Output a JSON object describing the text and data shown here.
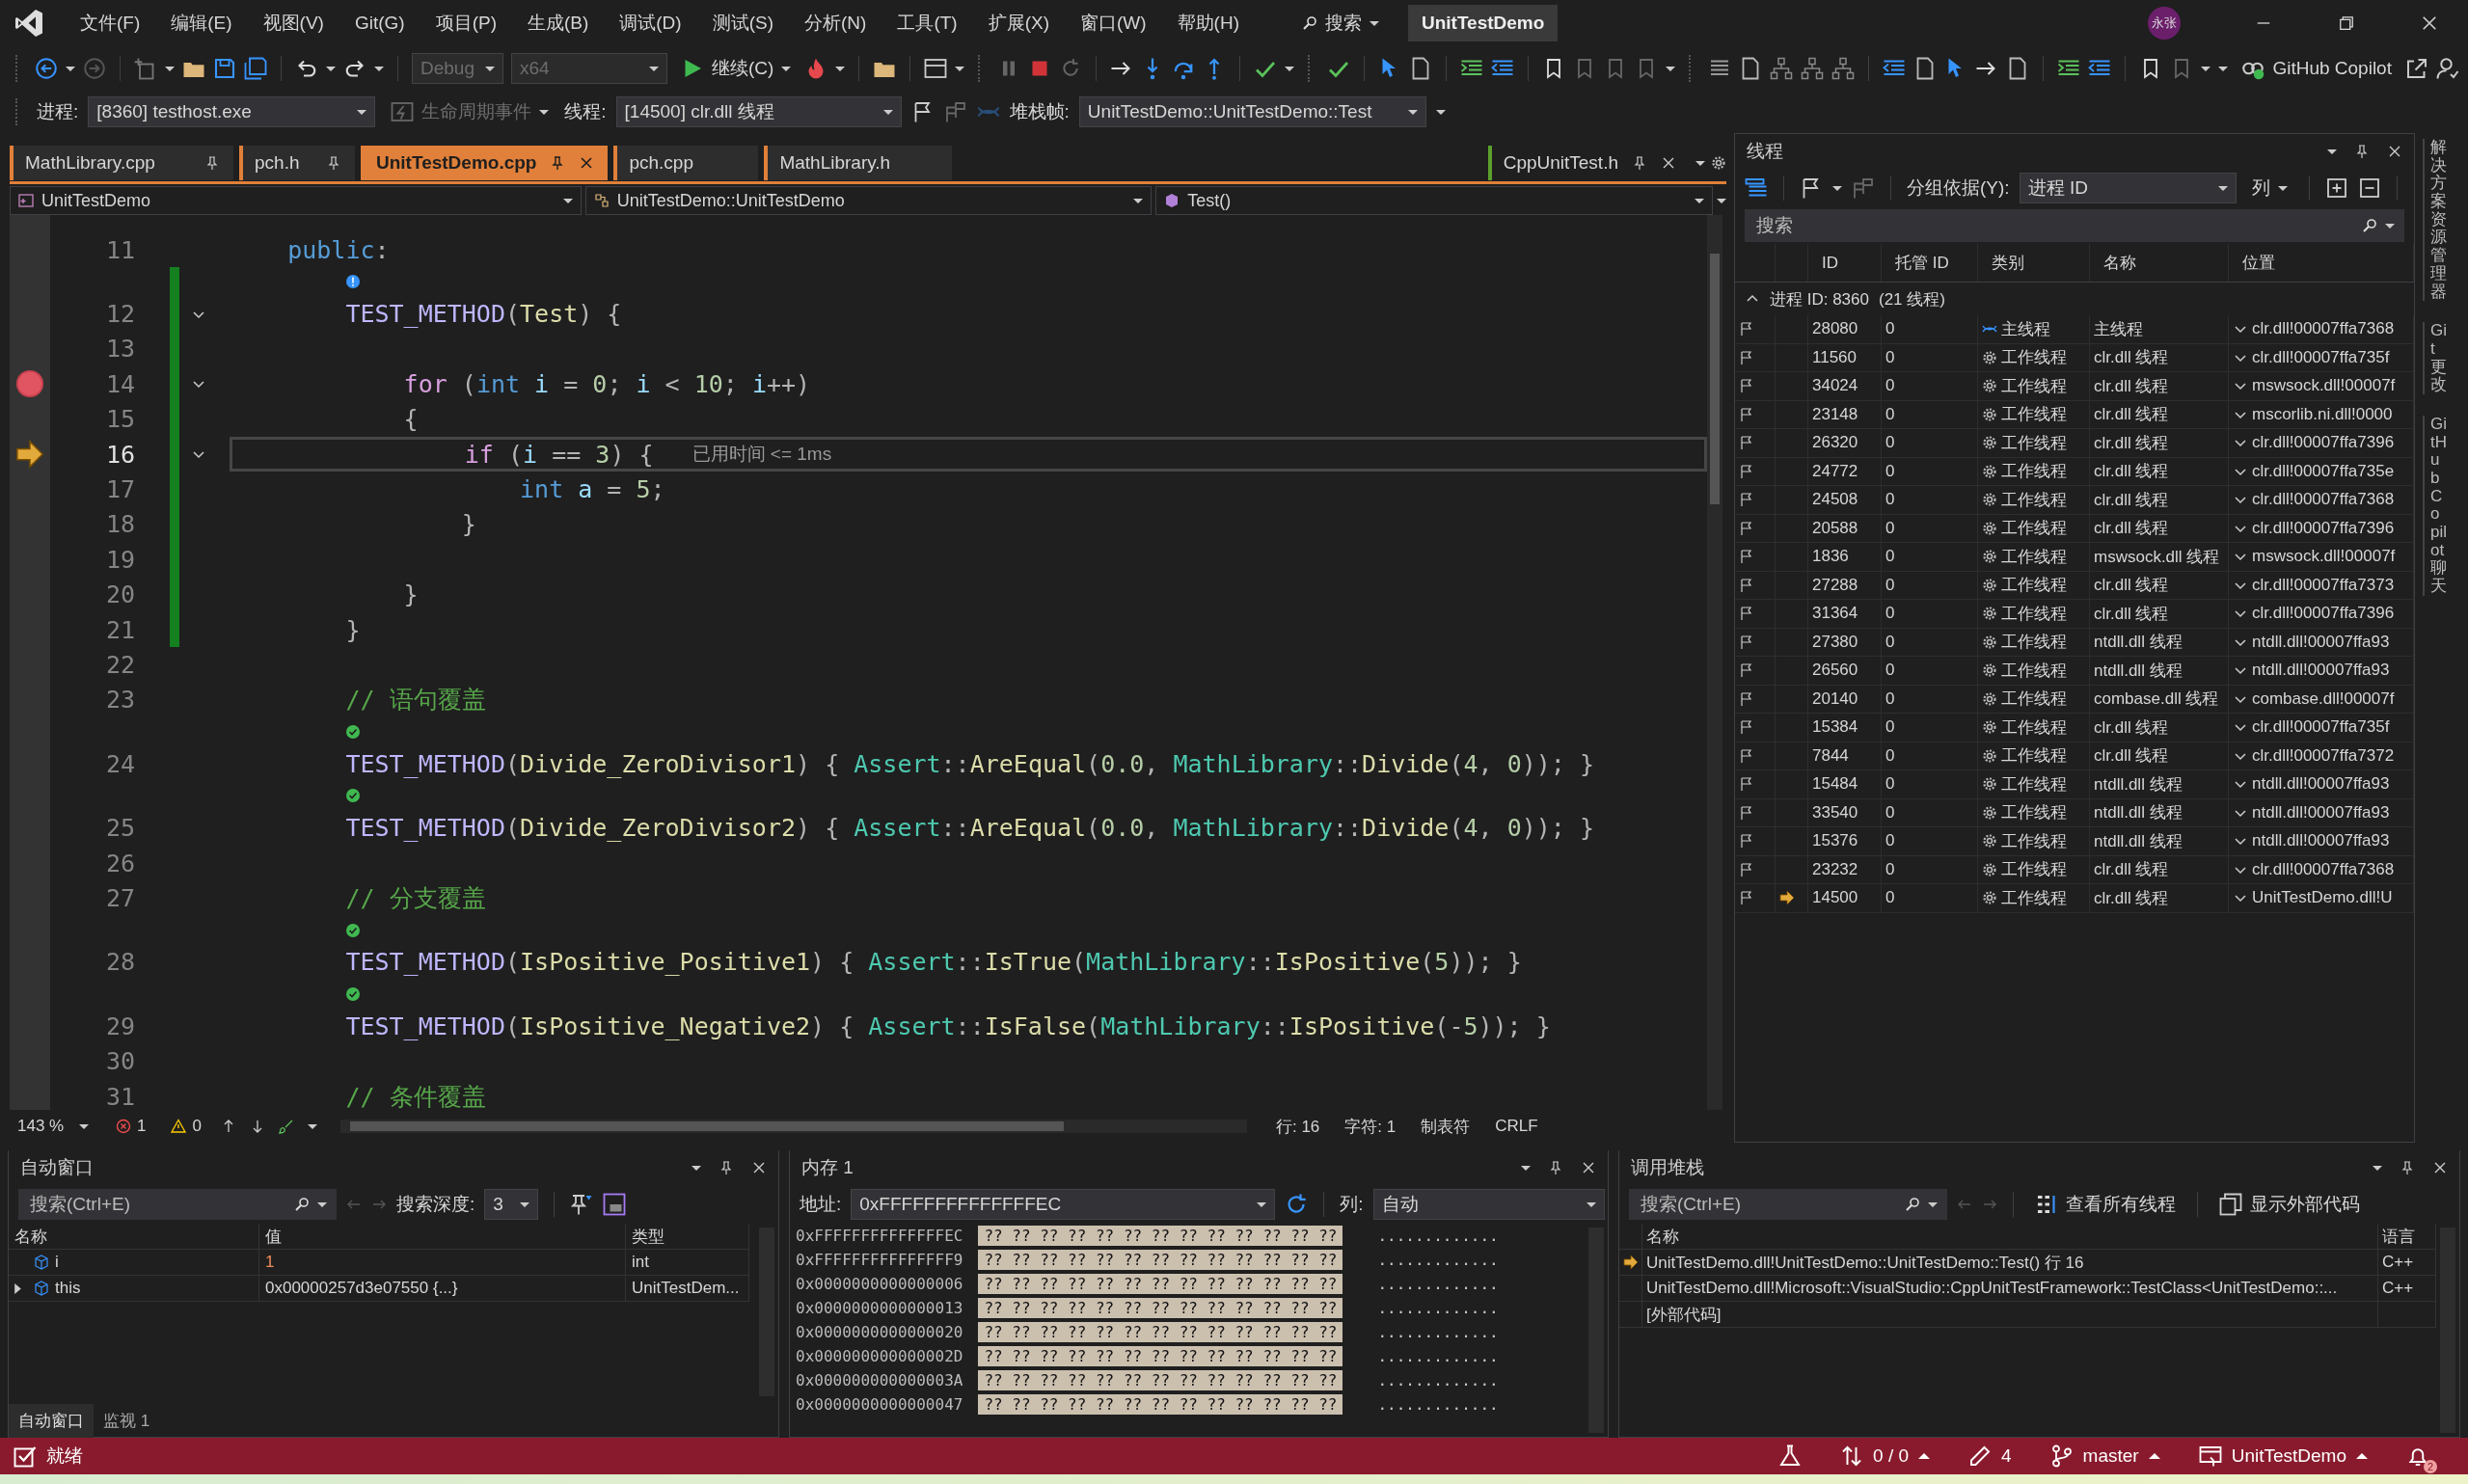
{
  "menu": {
    "items": [
      "文件(F)",
      "编辑(E)",
      "视图(V)",
      "Git(G)",
      "项目(P)",
      "生成(B)",
      "调试(D)",
      "测试(S)",
      "分析(N)",
      "工具(T)",
      "扩展(X)",
      "窗口(W)",
      "帮助(H)"
    ],
    "search": "搜索",
    "solution": "UnitTestDemo",
    "avatar": "永张"
  },
  "toolbar": {
    "configuration": {
      "value": "Debug",
      "disabled": true
    },
    "platform": {
      "value": "x64",
      "disabled": true
    },
    "continue": "继续(C)",
    "copilot": "GitHub Copilot"
  },
  "debug_location": {
    "process_label": "进程:",
    "process": "[8360] testhost.exe",
    "lifecycle": {
      "label": "生命周期事件",
      "disabled": true
    },
    "thread_label": "线程:",
    "thread": "[14500] clr.dll 线程",
    "frame_label": "堆栈帧:",
    "frame": "UnitTestDemo::UnitTestDemo::Test"
  },
  "tabs": [
    {
      "label": "MathLibrary.cpp",
      "selected": false,
      "pinned": true
    },
    {
      "label": "pch.h",
      "selected": false,
      "pinned": true
    },
    {
      "label": "UnitTestDemo.cpp",
      "selected": true,
      "pinned": true
    },
    {
      "label": "pch.cpp",
      "selected": false,
      "pinned": false
    },
    {
      "label": "MathLibrary.h",
      "selected": false,
      "pinned": false
    }
  ],
  "right_tabs": [
    {
      "label": "CppUnitTest.h",
      "selected": false,
      "pinned": true
    }
  ],
  "navigation": {
    "project": "UnitTestDemo",
    "scope": "UnitTestDemo::UnitTestDemo",
    "member": "Test()"
  },
  "code": {
    "lines": [
      {
        "number": "11",
        "changed": false,
        "fold": false,
        "parts": [
          {
            "text": "    public",
            "kind": "kw"
          },
          {
            "text": ":",
            "kind": "p"
          }
        ]
      },
      {
        "number": "12",
        "lens": {
          "kind": "info"
        },
        "changed": true,
        "fold": true,
        "parts": [
          {
            "text": "        TEST_METHOD",
            "kind": "macro"
          },
          {
            "text": "(",
            "kind": "p"
          },
          {
            "text": "Test",
            "kind": "fn"
          },
          {
            "text": ") {",
            "kind": "p"
          }
        ]
      },
      {
        "number": "13",
        "changed": true,
        "fold": false
      },
      {
        "number": "14",
        "marker": {
          "kind": "breakpoint"
        },
        "changed": true,
        "fold": true,
        "parts": [
          {
            "text": "            for",
            "kind": "ctl"
          },
          {
            "text": " (",
            "kind": "p"
          },
          {
            "text": "int ",
            "kind": "kw"
          },
          {
            "text": "i",
            "kind": "var"
          },
          {
            "text": " = ",
            "kind": "p"
          },
          {
            "text": "0",
            "kind": "num"
          },
          {
            "text": "; ",
            "kind": "p"
          },
          {
            "text": "i",
            "kind": "var"
          },
          {
            "text": " < ",
            "kind": "p"
          },
          {
            "text": "10",
            "kind": "num"
          },
          {
            "text": "; ",
            "kind": "p"
          },
          {
            "text": "i",
            "kind": "var"
          },
          {
            "text": "++)",
            "kind": "p"
          }
        ]
      },
      {
        "number": "15",
        "changed": true,
        "fold": false,
        "parts": [
          {
            "text": "            {",
            "kind": "p"
          }
        ]
      },
      {
        "number": "16",
        "marker": {
          "kind": "current"
        },
        "changed": true,
        "fold": true,
        "hint": "已用时间 <= 1ms",
        "parts": [
          {
            "text": "                if",
            "kind": "ctl"
          },
          {
            "text": " (",
            "kind": "p"
          },
          {
            "text": "i",
            "kind": "var"
          },
          {
            "text": " == ",
            "kind": "p"
          },
          {
            "text": "3",
            "kind": "num"
          },
          {
            "text": ") {",
            "kind": "p"
          }
        ]
      },
      {
        "number": "17",
        "changed": true,
        "fold": false,
        "parts": [
          {
            "text": "                    int ",
            "kind": "kw"
          },
          {
            "text": "a",
            "kind": "var"
          },
          {
            "text": " = ",
            "kind": "p"
          },
          {
            "text": "5",
            "kind": "num"
          },
          {
            "text": ";",
            "kind": "p"
          }
        ]
      },
      {
        "number": "18",
        "changed": true,
        "fold": false,
        "parts": [
          {
            "text": "                }",
            "kind": "p"
          }
        ]
      },
      {
        "number": "19",
        "changed": true,
        "fold": false
      },
      {
        "number": "20",
        "changed": true,
        "fold": false,
        "parts": [
          {
            "text": "            }",
            "kind": "p"
          }
        ]
      },
      {
        "number": "21",
        "changed": true,
        "fold": false,
        "parts": [
          {
            "text": "        }",
            "kind": "p"
          }
        ]
      },
      {
        "number": "22",
        "changed": false,
        "fold": false
      },
      {
        "number": "23",
        "changed": false,
        "fold": false,
        "parts": [
          {
            "text": "        // 语句覆盖",
            "kind": "cm"
          }
        ]
      },
      {
        "number": "24",
        "lens": {
          "kind": "pass"
        },
        "changed": false,
        "fold": false,
        "parts": [
          {
            "text": "        TEST_METHOD",
            "kind": "macro"
          },
          {
            "text": "(",
            "kind": "p"
          },
          {
            "text": "Divide_ZeroDivisor1",
            "kind": "fn"
          },
          {
            "text": ") { ",
            "kind": "p"
          },
          {
            "text": "Assert",
            "kind": "type"
          },
          {
            "text": "::",
            "kind": "p"
          },
          {
            "text": "AreEqual",
            "kind": "fn"
          },
          {
            "text": "(",
            "kind": "p"
          },
          {
            "text": "0.0",
            "kind": "num"
          },
          {
            "text": ", ",
            "kind": "p"
          },
          {
            "text": "MathLibrary",
            "kind": "type"
          },
          {
            "text": "::",
            "kind": "p"
          },
          {
            "text": "Divide",
            "kind": "fn"
          },
          {
            "text": "(",
            "kind": "p"
          },
          {
            "text": "4",
            "kind": "num"
          },
          {
            "text": ", ",
            "kind": "p"
          },
          {
            "text": "0",
            "kind": "num"
          },
          {
            "text": ")); }",
            "kind": "p"
          }
        ]
      },
      {
        "number": "25",
        "lens": {
          "kind": "pass"
        },
        "changed": false,
        "fold": false,
        "parts": [
          {
            "text": "        TEST_METHOD",
            "kind": "macro"
          },
          {
            "text": "(",
            "kind": "p"
          },
          {
            "text": "Divide_ZeroDivisor2",
            "kind": "fn"
          },
          {
            "text": ") { ",
            "kind": "p"
          },
          {
            "text": "Assert",
            "kind": "type"
          },
          {
            "text": "::",
            "kind": "p"
          },
          {
            "text": "AreEqual",
            "kind": "fn"
          },
          {
            "text": "(",
            "kind": "p"
          },
          {
            "text": "0.0",
            "kind": "num"
          },
          {
            "text": ", ",
            "kind": "p"
          },
          {
            "text": "MathLibrary",
            "kind": "type"
          },
          {
            "text": "::",
            "kind": "p"
          },
          {
            "text": "Divide",
            "kind": "fn"
          },
          {
            "text": "(",
            "kind": "p"
          },
          {
            "text": "4",
            "kind": "num"
          },
          {
            "text": ", ",
            "kind": "p"
          },
          {
            "text": "0",
            "kind": "num"
          },
          {
            "text": ")); }",
            "kind": "p"
          }
        ]
      },
      {
        "number": "26",
        "changed": false,
        "fold": false
      },
      {
        "number": "27",
        "changed": false,
        "fold": false,
        "parts": [
          {
            "text": "        // 分支覆盖",
            "kind": "cm"
          }
        ]
      },
      {
        "number": "28",
        "lens": {
          "kind": "pass"
        },
        "changed": false,
        "fold": false,
        "parts": [
          {
            "text": "        TEST_METHOD",
            "kind": "macro"
          },
          {
            "text": "(",
            "kind": "p"
          },
          {
            "text": "IsPositive_Positive1",
            "kind": "fn"
          },
          {
            "text": ") { ",
            "kind": "p"
          },
          {
            "text": "Assert",
            "kind": "type"
          },
          {
            "text": "::",
            "kind": "p"
          },
          {
            "text": "IsTrue",
            "kind": "fn"
          },
          {
            "text": "(",
            "kind": "p"
          },
          {
            "text": "MathLibrary",
            "kind": "type"
          },
          {
            "text": "::",
            "kind": "p"
          },
          {
            "text": "IsPositive",
            "kind": "fn"
          },
          {
            "text": "(",
            "kind": "p"
          },
          {
            "text": "5",
            "kind": "num"
          },
          {
            "text": ")); }",
            "kind": "p"
          }
        ]
      },
      {
        "number": "29",
        "lens": {
          "kind": "pass"
        },
        "changed": false,
        "fold": false,
        "parts": [
          {
            "text": "        TEST_METHOD",
            "kind": "macro"
          },
          {
            "text": "(",
            "kind": "p"
          },
          {
            "text": "IsPositive_Negative2",
            "kind": "fn"
          },
          {
            "text": ") { ",
            "kind": "p"
          },
          {
            "text": "Assert",
            "kind": "type"
          },
          {
            "text": "::",
            "kind": "p"
          },
          {
            "text": "IsFalse",
            "kind": "fn"
          },
          {
            "text": "(",
            "kind": "p"
          },
          {
            "text": "MathLibrary",
            "kind": "type"
          },
          {
            "text": "::",
            "kind": "p"
          },
          {
            "text": "IsPositive",
            "kind": "fn"
          },
          {
            "text": "(-",
            "kind": "p"
          },
          {
            "text": "5",
            "kind": "num"
          },
          {
            "text": ")); }",
            "kind": "p"
          }
        ]
      },
      {
        "number": "30",
        "changed": false,
        "fold": false
      },
      {
        "number": "31",
        "changed": false,
        "fold": false,
        "parts": [
          {
            "text": "        // 条件覆盖",
            "kind": "cm"
          }
        ]
      }
    ]
  },
  "editor_status": {
    "zoom": "143 %",
    "errors": "1",
    "warnings": "0",
    "line": "行: 16",
    "char": "字符: 1",
    "indent": "制表符",
    "eol": "CRLF"
  },
  "threads": {
    "title": "线程",
    "group_label": "分组依据(Y):",
    "group_by": "进程 ID",
    "columns_button": "列",
    "search": {
      "placeholder": "搜索"
    },
    "columns": [
      "ID",
      "托管 ID",
      "类别",
      "名称",
      "位置"
    ],
    "group": {
      "label": "进程 ID: 8360",
      "count": "(21 线程)",
      "expanded": true
    },
    "rows": [
      {
        "thread_id": "28080",
        "managed": "0",
        "kind": "main",
        "category": "主线程",
        "name": "主线程",
        "location": "clr.dll!00007ffa7368",
        "current": false
      },
      {
        "thread_id": "11560",
        "managed": "0",
        "kind": "worker",
        "category": "工作线程",
        "name": "clr.dll 线程",
        "location": "clr.dll!00007ffa735f",
        "current": false
      },
      {
        "thread_id": "34024",
        "managed": "0",
        "kind": "worker",
        "category": "工作线程",
        "name": "clr.dll 线程",
        "location": "mswsock.dll!00007f",
        "current": false
      },
      {
        "thread_id": "23148",
        "managed": "0",
        "kind": "worker",
        "category": "工作线程",
        "name": "clr.dll 线程",
        "location": "mscorlib.ni.dll!0000",
        "current": false
      },
      {
        "thread_id": "26320",
        "managed": "0",
        "kind": "worker",
        "category": "工作线程",
        "name": "clr.dll 线程",
        "location": "clr.dll!00007ffa7396",
        "current": false
      },
      {
        "thread_id": "24772",
        "managed": "0",
        "kind": "worker",
        "category": "工作线程",
        "name": "clr.dll 线程",
        "location": "clr.dll!00007ffa735e",
        "current": false
      },
      {
        "thread_id": "24508",
        "managed": "0",
        "kind": "worker",
        "category": "工作线程",
        "name": "clr.dll 线程",
        "location": "clr.dll!00007ffa7368",
        "current": false
      },
      {
        "thread_id": "20588",
        "managed": "0",
        "kind": "worker",
        "category": "工作线程",
        "name": "clr.dll 线程",
        "location": "clr.dll!00007ffa7396",
        "current": false
      },
      {
        "thread_id": "1836",
        "managed": "0",
        "kind": "worker",
        "category": "工作线程",
        "name": "mswsock.dll 线程",
        "location": "mswsock.dll!00007f",
        "current": false
      },
      {
        "thread_id": "27288",
        "managed": "0",
        "kind": "worker",
        "category": "工作线程",
        "name": "clr.dll 线程",
        "location": "clr.dll!00007ffa7373",
        "current": false
      },
      {
        "thread_id": "31364",
        "managed": "0",
        "kind": "worker",
        "category": "工作线程",
        "name": "clr.dll 线程",
        "location": "clr.dll!00007ffa7396",
        "current": false
      },
      {
        "thread_id": "27380",
        "managed": "0",
        "kind": "worker",
        "category": "工作线程",
        "name": "ntdll.dll 线程",
        "location": "ntdll.dll!00007ffa93",
        "current": false
      },
      {
        "thread_id": "26560",
        "managed": "0",
        "kind": "worker",
        "category": "工作线程",
        "name": "ntdll.dll 线程",
        "location": "ntdll.dll!00007ffa93",
        "current": false
      },
      {
        "thread_id": "20140",
        "managed": "0",
        "kind": "worker",
        "category": "工作线程",
        "name": "combase.dll 线程",
        "location": "combase.dll!00007f",
        "current": false
      },
      {
        "thread_id": "15384",
        "managed": "0",
        "kind": "worker",
        "category": "工作线程",
        "name": "clr.dll 线程",
        "location": "clr.dll!00007ffa735f",
        "current": false
      },
      {
        "thread_id": "7844",
        "managed": "0",
        "kind": "worker",
        "category": "工作线程",
        "name": "clr.dll 线程",
        "location": "clr.dll!00007ffa7372",
        "current": false
      },
      {
        "thread_id": "15484",
        "managed": "0",
        "kind": "worker",
        "category": "工作线程",
        "name": "ntdll.dll 线程",
        "location": "ntdll.dll!00007ffa93",
        "current": false
      },
      {
        "thread_id": "33540",
        "managed": "0",
        "kind": "worker",
        "category": "工作线程",
        "name": "ntdll.dll 线程",
        "location": "ntdll.dll!00007ffa93",
        "current": false
      },
      {
        "thread_id": "15376",
        "managed": "0",
        "kind": "worker",
        "category": "工作线程",
        "name": "ntdll.dll 线程",
        "location": "ntdll.dll!00007ffa93",
        "current": false
      },
      {
        "thread_id": "23232",
        "managed": "0",
        "kind": "worker",
        "category": "工作线程",
        "name": "clr.dll 线程",
        "location": "clr.dll!00007ffa7368",
        "current": false
      },
      {
        "thread_id": "14500",
        "managed": "0",
        "kind": "worker",
        "category": "工作线程",
        "name": "clr.dll 线程",
        "location": "UnitTestDemo.dll!U",
        "current": true
      }
    ]
  },
  "side_tabs": [
    "解决方案资源管理器",
    "Git 更改",
    "GitHub Copilot 聊天"
  ],
  "autos": {
    "title": "自动窗口",
    "search": {
      "placeholder": "搜索(Ctrl+E)"
    },
    "depth_label": "搜索深度:",
    "depth": "3",
    "columns": [
      "名称",
      "值",
      "类型"
    ],
    "rows": [
      {
        "name": "i",
        "value": "1",
        "type": "int",
        "changed": true,
        "expandable": false
      },
      {
        "name": "this",
        "value": "0x00000257d3e07550 {...}",
        "type": "UnitTestDem...",
        "changed": false,
        "expandable": true
      }
    ],
    "tabs": [
      {
        "label": "自动窗口",
        "selected": true
      },
      {
        "label": "监视 1",
        "selected": false
      }
    ]
  },
  "memory": {
    "title": "内存 1",
    "address_label": "地址:",
    "address": "0xFFFFFFFFFFFFFFEC",
    "columns_label": "列:",
    "columns": "自动",
    "rows": [
      {
        "address": "0xFFFFFFFFFFFFFFEC",
        "bytes": "?? ?? ?? ?? ?? ?? ?? ?? ?? ?? ?? ?? ??",
        "text": "............."
      },
      {
        "address": "0xFFFFFFFFFFFFFFF9",
        "bytes": "?? ?? ?? ?? ?? ?? ?? ?? ?? ?? ?? ?? ??",
        "text": "............."
      },
      {
        "address": "0x0000000000000006",
        "bytes": "?? ?? ?? ?? ?? ?? ?? ?? ?? ?? ?? ?? ??",
        "text": "............."
      },
      {
        "address": "0x0000000000000013",
        "bytes": "?? ?? ?? ?? ?? ?? ?? ?? ?? ?? ?? ?? ??",
        "text": "............."
      },
      {
        "address": "0x0000000000000020",
        "bytes": "?? ?? ?? ?? ?? ?? ?? ?? ?? ?? ?? ?? ??",
        "text": "............."
      },
      {
        "address": "0x000000000000002D",
        "bytes": "?? ?? ?? ?? ?? ?? ?? ?? ?? ?? ?? ?? ??",
        "text": "............."
      },
      {
        "address": "0x000000000000003A",
        "bytes": "?? ?? ?? ?? ?? ?? ?? ?? ?? ?? ?? ?? ??",
        "text": "............."
      },
      {
        "address": "0x0000000000000047",
        "bytes": "?? ?? ?? ?? ?? ?? ?? ?? ?? ?? ?? ?? ??",
        "text": "............."
      }
    ]
  },
  "call_stack": {
    "title": "调用堆栈",
    "search": {
      "placeholder": "搜索(Ctrl+E)"
    },
    "all_threads": "查看所有线程",
    "external": "显示外部代码",
    "columns": [
      "名称",
      "语言"
    ],
    "rows": [
      {
        "name": "UnitTestDemo.dll!UnitTestDemo::UnitTestDemo::Test() 行 16",
        "language": "C++",
        "current": true
      },
      {
        "name": "UnitTestDemo.dll!Microsoft::VisualStudio::CppUnitTestFramework::TestClass<UnitTestDemo::...",
        "language": "C++",
        "current": false
      },
      {
        "name": "[外部代码]",
        "current": false
      }
    ]
  },
  "status_bar": {
    "state": "就绪",
    "sync": "0 / 0",
    "changes": "4",
    "branch": "master",
    "repo": "UnitTestDemo",
    "notifications": "2"
  }
}
